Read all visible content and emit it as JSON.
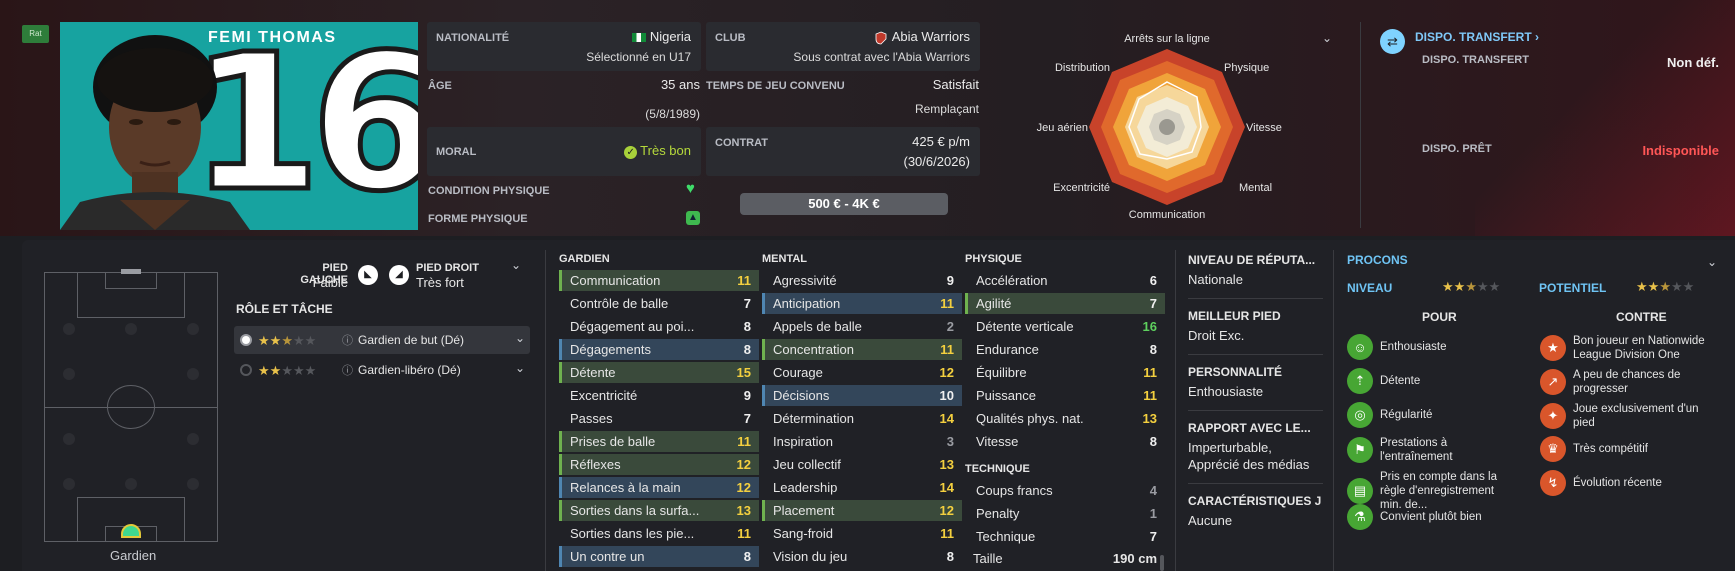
{
  "header": {
    "rating_badge": "Rat",
    "player_name": "FEMI THOMAS",
    "shirt_number": "16"
  },
  "info": {
    "nationality_label": "NATIONALITÉ",
    "nationality_value": "Nigeria",
    "nationality_sub": "Sélectionné en U17",
    "club_label": "CLUB",
    "club_value": "Abia Warriors",
    "club_sub": "Sous contrat avec l'Abia Warriors",
    "age_label": "ÂGE",
    "age_value": "35 ans",
    "age_sub": "(5/8/1989)",
    "playtime_label": "TEMPS DE JEU CONVENU",
    "playtime_value": "Satisfait",
    "playtime_sub": "Remplaçant",
    "morale_label": "MORAL",
    "morale_value": "Très bon",
    "contract_label": "CONTRAT",
    "contract_value": "425 € p/m",
    "contract_sub": "(30/6/2026)",
    "condition_label": "CONDITION PHYSIQUE",
    "form_label": "FORME PHYSIQUE",
    "value_range": "500 € - 4K €"
  },
  "radar": {
    "labels": [
      "Arrêts sur la ligne",
      "Physique",
      "Vitesse",
      "Mental",
      "Communication",
      "Excentricité",
      "Jeu aérien",
      "Distribution"
    ]
  },
  "transfer": {
    "title": "DISPO. TRANSFERT",
    "transfer_label": "DISPO. TRANSFERT",
    "transfer_value": "Non déf.",
    "loan_label": "DISPO. PRÊT",
    "loan_value": "Indisponible"
  },
  "feet": {
    "left_label": "PIED GAUCHE",
    "left_value": "Faible",
    "right_label": "PIED DROIT",
    "right_value": "Très fort"
  },
  "roles": {
    "title": "RÔLE ET TÂCHE",
    "items": [
      {
        "label": "Gardien de but (Dé)",
        "stars": 2.5
      },
      {
        "label": "Gardien-libéro (Dé)",
        "stars": 2
      }
    ]
  },
  "pitch": {
    "position_label": "Gardien"
  },
  "gardien": {
    "title": "GARDIEN",
    "rows": [
      {
        "name": "Communication",
        "value": "11",
        "hl": "green",
        "color": "yellow"
      },
      {
        "name": "Contrôle de balle",
        "value": "7",
        "hl": "",
        "color": "white"
      },
      {
        "name": "Dégagement au poi...",
        "value": "8",
        "hl": "",
        "color": "white"
      },
      {
        "name": "Dégagements",
        "value": "8",
        "hl": "blue",
        "color": "white"
      },
      {
        "name": "Détente",
        "value": "15",
        "hl": "green",
        "color": "yellow"
      },
      {
        "name": "Excentricité",
        "value": "9",
        "hl": "",
        "color": "white"
      },
      {
        "name": "Passes",
        "value": "7",
        "hl": "",
        "color": "white"
      },
      {
        "name": "Prises de balle",
        "value": "11",
        "hl": "green",
        "color": "yellow"
      },
      {
        "name": "Réflexes",
        "value": "12",
        "hl": "green",
        "color": "yellow"
      },
      {
        "name": "Relances à la main",
        "value": "12",
        "hl": "blue",
        "color": "yellow"
      },
      {
        "name": "Sorties dans la surfa...",
        "value": "13",
        "hl": "green",
        "color": "yellow"
      },
      {
        "name": "Sorties dans les pie...",
        "value": "11",
        "hl": "",
        "color": "yellow"
      },
      {
        "name": "Un contre un",
        "value": "8",
        "hl": "blue",
        "color": "white"
      }
    ]
  },
  "mental": {
    "title": "MENTAL",
    "rows": [
      {
        "name": "Agressivité",
        "value": "9",
        "hl": "",
        "color": "white"
      },
      {
        "name": "Anticipation",
        "value": "11",
        "hl": "blue",
        "color": "yellow"
      },
      {
        "name": "Appels de balle",
        "value": "2",
        "hl": "",
        "color": "gray"
      },
      {
        "name": "Concentration",
        "value": "11",
        "hl": "green",
        "color": "yellow"
      },
      {
        "name": "Courage",
        "value": "12",
        "hl": "",
        "color": "yellow"
      },
      {
        "name": "Décisions",
        "value": "10",
        "hl": "blue",
        "color": "white"
      },
      {
        "name": "Détermination",
        "value": "14",
        "hl": "",
        "color": "yellow"
      },
      {
        "name": "Inspiration",
        "value": "3",
        "hl": "",
        "color": "gray"
      },
      {
        "name": "Jeu collectif",
        "value": "13",
        "hl": "",
        "color": "yellow"
      },
      {
        "name": "Leadership",
        "value": "14",
        "hl": "",
        "color": "yellow"
      },
      {
        "name": "Placement",
        "value": "12",
        "hl": "green",
        "color": "yellow"
      },
      {
        "name": "Sang-froid",
        "value": "11",
        "hl": "",
        "color": "yellow"
      },
      {
        "name": "Vision du jeu",
        "value": "8",
        "hl": "",
        "color": "white"
      }
    ]
  },
  "physique": {
    "title": "PHYSIQUE",
    "rows": [
      {
        "name": "Accélération",
        "value": "6",
        "hl": "",
        "color": "white"
      },
      {
        "name": "Agilité",
        "value": "7",
        "hl": "green",
        "color": "white"
      },
      {
        "name": "Détente verticale",
        "value": "16",
        "hl": "",
        "color": "green"
      },
      {
        "name": "Endurance",
        "value": "8",
        "hl": "",
        "color": "white"
      },
      {
        "name": "Équilibre",
        "value": "11",
        "hl": "",
        "color": "yellow"
      },
      {
        "name": "Puissance",
        "value": "11",
        "hl": "",
        "color": "yellow"
      },
      {
        "name": "Qualités phys. nat.",
        "value": "13",
        "hl": "",
        "color": "yellow"
      },
      {
        "name": "Vitesse",
        "value": "8",
        "hl": "",
        "color": "white"
      }
    ],
    "technique_title": "TECHNIQUE",
    "technique_rows": [
      {
        "name": "Coups francs",
        "value": "4",
        "hl": "",
        "color": "gray"
      },
      {
        "name": "Penalty",
        "value": "1",
        "hl": "",
        "color": "gray"
      },
      {
        "name": "Technique",
        "value": "7",
        "hl": "",
        "color": "white"
      }
    ],
    "height_label": "Taille",
    "height_value": "190 cm"
  },
  "info_col": {
    "reputation_label": "NIVEAU DE RÉPUTA...",
    "reputation_value": "Nationale",
    "best_foot_label": "MEILLEUR PIED",
    "best_foot_value": "Droit Exc.",
    "personality_label": "PERSONNALITÉ",
    "personality_value": "Enthousiaste",
    "media_label": "RAPPORT AVEC LE...",
    "media_value1": "Imperturbable,",
    "media_value2": "Apprécié des médias",
    "traits_label": "CARACTÉRISTIQUES J",
    "traits_value": "Aucune"
  },
  "procons": {
    "title": "PROCONS",
    "level_label": "NIVEAU",
    "level_stars": 2.5,
    "potential_label": "POTENTIEL",
    "potential_stars": 2.5,
    "pros_title": "POUR",
    "cons_title": "CONTRE",
    "pros": [
      {
        "icon": "brain-icon",
        "text": "Enthousiaste"
      },
      {
        "icon": "jump-icon",
        "text": "Détente"
      },
      {
        "icon": "target-icon",
        "text": "Régularité"
      },
      {
        "icon": "training-icon",
        "text": "Prestations à l'entraînement"
      },
      {
        "icon": "document-icon",
        "text": "Pris en compte dans la règle d'enregistrement min. de..."
      },
      {
        "icon": "flask-icon",
        "text": "Convient plutôt bien"
      }
    ],
    "cons": [
      {
        "icon": "star-icon",
        "text": "Bon joueur en Nationwide League Division One"
      },
      {
        "icon": "trend-icon",
        "text": "A peu de chances de progresser"
      },
      {
        "icon": "foot-icon",
        "text": "Joue exclusivement d'un pied"
      },
      {
        "icon": "trophy-icon",
        "text": "Très compétitif"
      },
      {
        "icon": "whistle-icon",
        "text": "Évolution récente"
      }
    ]
  }
}
